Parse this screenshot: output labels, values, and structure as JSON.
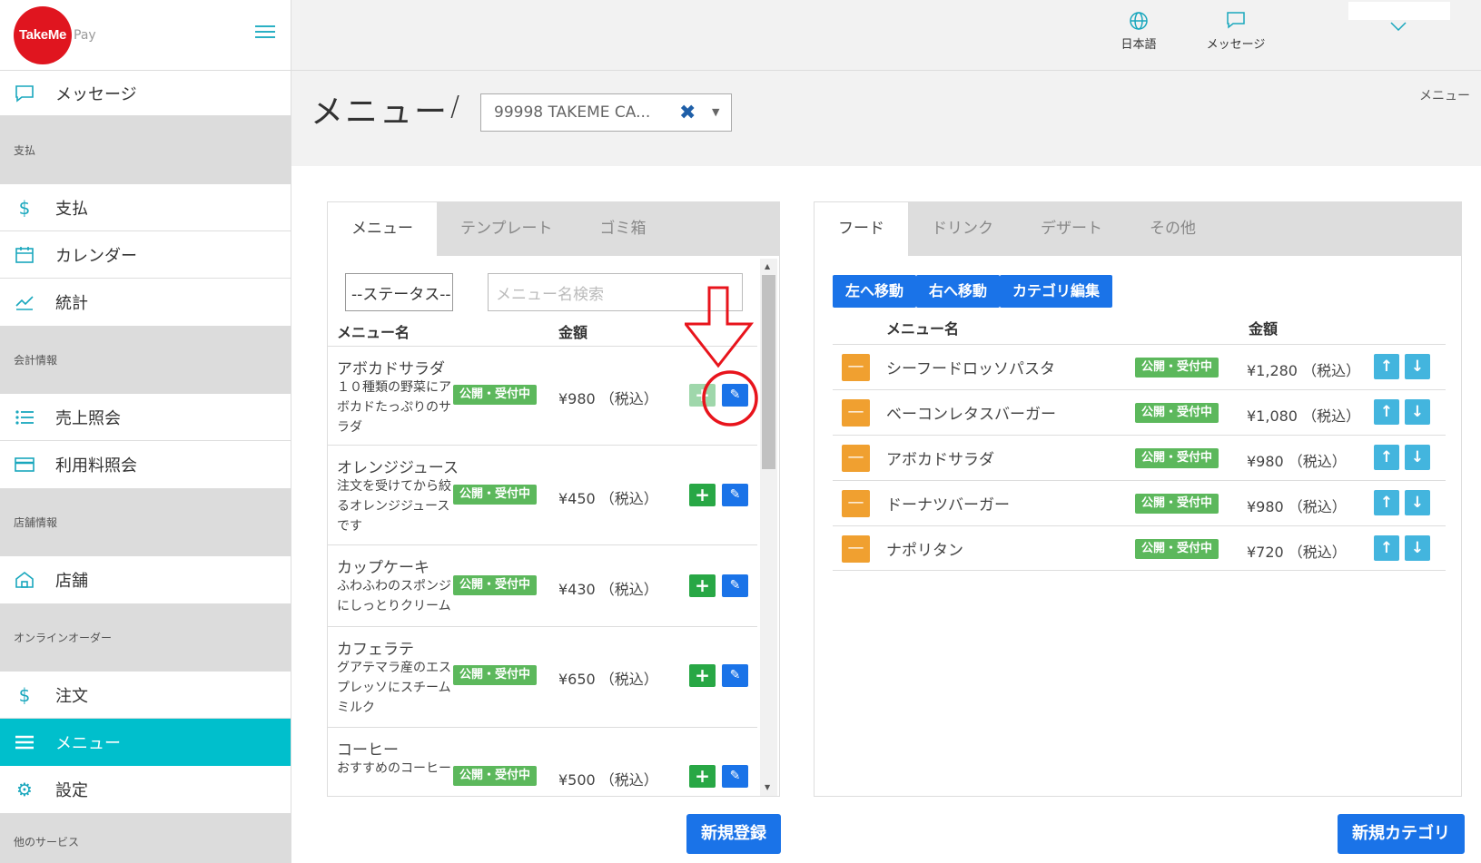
{
  "brand": {
    "logo_text": "TakeMe",
    "logo_suffix": "Pay"
  },
  "header": {
    "language_label": "日本語",
    "messages_label": "メッセージ"
  },
  "sidebar": {
    "top_item": "メッセージ",
    "sections": [
      {
        "title": "支払",
        "items": [
          "支払",
          "カレンダー",
          "統計"
        ]
      },
      {
        "title": "会計情報",
        "items": [
          "売上照会",
          "利用料照会"
        ]
      },
      {
        "title": "店舗情報",
        "items": [
          "店舗"
        ]
      },
      {
        "title": "オンラインオーダー",
        "items": [
          "注文",
          "メニュー",
          "設定"
        ]
      },
      {
        "title": "他のサービス",
        "items": []
      }
    ],
    "active_item": "メニュー"
  },
  "page": {
    "title": "メニュー",
    "separator": "/",
    "store_select_value": "99998 TAKEME CA...",
    "breadcrumb": "メニュー"
  },
  "left_panel": {
    "tabs": [
      "メニュー",
      "テンプレート",
      "ゴミ箱"
    ],
    "status_filter": "--ステータス--",
    "search_placeholder": "メニュー名検索",
    "col_name": "メニュー名",
    "col_price": "金額",
    "items": [
      {
        "name": "アボカドサラダ",
        "desc": "１０種類の野菜にアボカドたっぷりのサラダ",
        "status": "公開・受付中",
        "price": "¥980 （税込）"
      },
      {
        "name": "オレンジジュース",
        "desc": "注文を受けてから絞るオレンジジュースです",
        "status": "公開・受付中",
        "price": "¥450 （税込）"
      },
      {
        "name": "カップケーキ",
        "desc": "ふわふわのスポンジにしっとりクリーム",
        "status": "公開・受付中",
        "price": "¥430 （税込）"
      },
      {
        "name": "カフェラテ",
        "desc": "グアテマラ産のエスプレッソにスチームミルク",
        "status": "公開・受付中",
        "price": "¥650 （税込）"
      },
      {
        "name": "コーヒー",
        "desc": "おすすめのコーヒー",
        "status": "公開・受付中",
        "price": "¥500 （税込）"
      }
    ],
    "new_button": "新規登録"
  },
  "right_panel": {
    "tabs": [
      "フード",
      "ドリンク",
      "デザート",
      "その他"
    ],
    "actions": [
      "左へ移動",
      "右へ移動",
      "カテゴリ編集"
    ],
    "col_name": "メニュー名",
    "col_price": "金額",
    "items": [
      {
        "name": "シーフードロッソパスタ",
        "status": "公開・受付中",
        "price": "¥1,280 （税込）"
      },
      {
        "name": "ベーコンレタスバーガー",
        "status": "公開・受付中",
        "price": "¥1,080 （税込）"
      },
      {
        "name": "アボカドサラダ",
        "status": "公開・受付中",
        "price": "¥980 （税込）"
      },
      {
        "name": "ドーナツバーガー",
        "status": "公開・受付中",
        "price": "¥980 （税込）"
      },
      {
        "name": "ナポリタン",
        "status": "公開・受付中",
        "price": "¥720 （税込）"
      }
    ],
    "new_button": "新規カテゴリ"
  },
  "colors": {
    "accent": "#00bfcc",
    "primary": "#1a73e8",
    "badge": "#5cb85c",
    "brand_red": "#e0151f",
    "annotation": "#e8141c"
  }
}
